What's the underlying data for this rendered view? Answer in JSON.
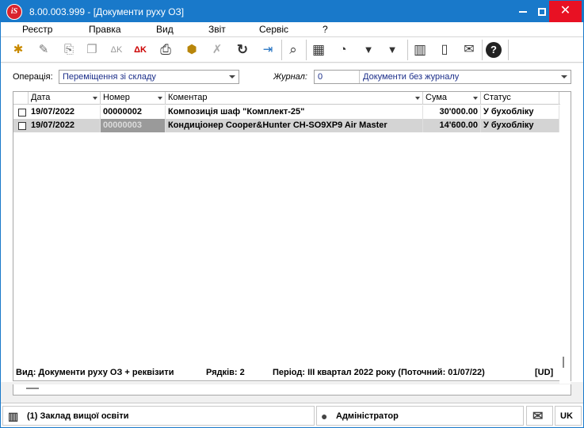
{
  "window": {
    "logo_text": "iS",
    "title": "8.00.003.999 - [Документи руху ОЗ]",
    "close_glyph": "✕"
  },
  "menu": [
    {
      "label": "Реєстр"
    },
    {
      "label": "Правка"
    },
    {
      "label": "Вид"
    },
    {
      "label": "Звіт"
    },
    {
      "label": "Сервіс"
    },
    {
      "label": "?"
    }
  ],
  "toolbar": {
    "icons": [
      {
        "name": "create-document-icon",
        "glyph": "✱"
      },
      {
        "name": "edit-document-icon",
        "glyph": "✎"
      },
      {
        "name": "copy-document-icon",
        "glyph": "⎘"
      },
      {
        "name": "duplicate-icon",
        "glyph": "❐"
      },
      {
        "name": "sign-icon",
        "glyph": "ΔK"
      },
      {
        "name": "unsign-icon",
        "glyph": "ΔK"
      },
      {
        "name": "print-icon",
        "glyph": "⎙"
      },
      {
        "name": "package-icon",
        "glyph": "⬢"
      },
      {
        "name": "delete-icon",
        "glyph": "✗"
      },
      {
        "name": "refresh-icon",
        "glyph": "↻"
      },
      {
        "name": "exit-icon",
        "glyph": "⇥"
      },
      {
        "name": "search-icon",
        "glyph": "⌕"
      },
      {
        "name": "table-icon",
        "glyph": "▦"
      },
      {
        "name": "period-icon",
        "glyph": "◔"
      },
      {
        "name": "filter-icon",
        "glyph": "▼"
      },
      {
        "name": "clear-filter-icon",
        "glyph": "▼"
      },
      {
        "name": "organization-icon",
        "glyph": "▥"
      },
      {
        "name": "notes-icon",
        "glyph": "▯"
      },
      {
        "name": "mail-icon",
        "glyph": "✉"
      },
      {
        "name": "help-icon",
        "glyph": "?"
      }
    ]
  },
  "filters": {
    "operation_label": "Операція:",
    "operation_value": "Переміщення зі складу",
    "journal_label": "Журнал:",
    "journal_code": "0",
    "journal_value": "Документи без журналу"
  },
  "grid": {
    "columns": [
      "Дата",
      "Номер",
      "Коментар",
      "Сума",
      "Статус"
    ],
    "rows": [
      {
        "date": "19/07/2022",
        "number": "00000002",
        "comment": "Композиція шаф \"Комплект-25\"",
        "sum": "30'000.00",
        "status": "У бухобліку"
      },
      {
        "date": "19/07/2022",
        "number": "00000003",
        "comment": "Кондиціонер Cooper&Hunter CH-SO9XP9 Air Master",
        "sum": "14'600.00",
        "status": "У бухобліку"
      }
    ],
    "summary": {
      "view": "Вид: Документи руху ОЗ + реквізити",
      "rows": "Рядків: 2",
      "period": "Період: III квартал 2022 року (Поточний: 01/07/22)",
      "mode": "[UD]"
    }
  },
  "statusbar": {
    "organization": "(1) Заклад вищої освіти",
    "user": "Адміністратор",
    "language": "UK"
  },
  "colors": {
    "titlebar": "#1979ca",
    "close": "#e81123",
    "selected_row": "#d4d4d4",
    "combo_text": "#1c2f8a"
  }
}
